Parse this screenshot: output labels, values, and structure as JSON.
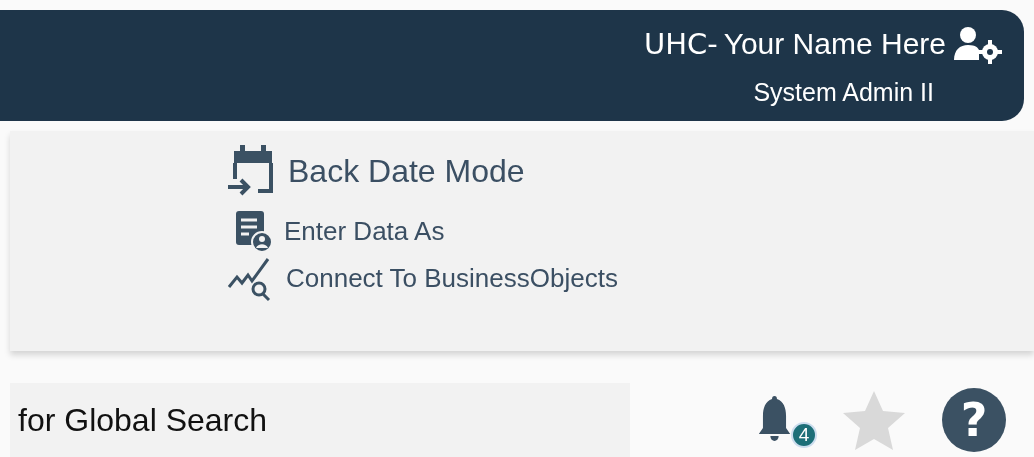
{
  "header": {
    "org": "UHC-",
    "user_name": "Your Name Here",
    "role": "System Admin II"
  },
  "menu": {
    "items": [
      {
        "kind": "calendar",
        "label": "Back Date Mode"
      },
      {
        "kind": "form-user",
        "label": "Enter Data As"
      },
      {
        "kind": "chart-search",
        "label": "Connect To BusinessObjects"
      }
    ]
  },
  "search": {
    "placeholder": "for Global Search"
  },
  "toolbar": {
    "notification_count": "4",
    "favorite": false,
    "help_label": "?"
  }
}
